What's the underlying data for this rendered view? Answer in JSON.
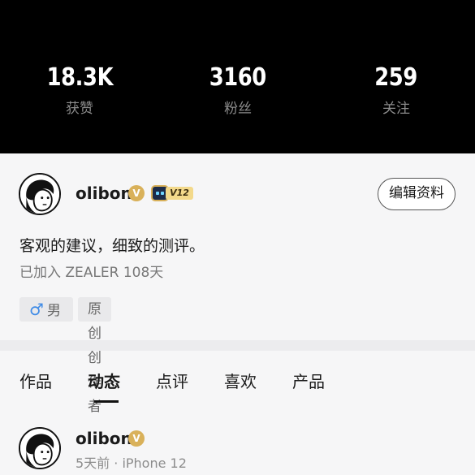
{
  "stats": [
    {
      "value": "18.3K",
      "label": "获赞"
    },
    {
      "value": "3160",
      "label": "粉丝"
    },
    {
      "value": "259",
      "label": "关注"
    }
  ],
  "profile": {
    "username": "olibon",
    "verified_icon": "verified-v-icon",
    "level": "V12",
    "edit_button": "编辑资料",
    "bio": "客观的建议，细致的测评。",
    "joined": "已加入 ZEALER 108天",
    "tags": {
      "gender_symbol": "♂",
      "gender": "男",
      "role": "原创创作者"
    }
  },
  "tabs": [
    "作品",
    "动态",
    "点评",
    "喜欢",
    "产品"
  ],
  "active_tab": "动态",
  "post": {
    "username": "olibon",
    "meta": "5天前 · iPhone 12"
  },
  "colors": {
    "header_bg": "#000000",
    "verified_gold": "#d9b15a",
    "gender_blue": "#3f8be6"
  }
}
